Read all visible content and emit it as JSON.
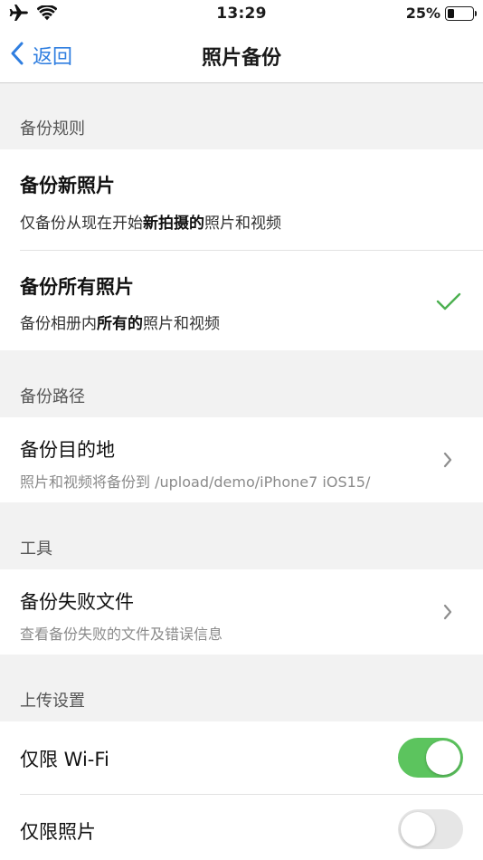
{
  "status_bar": {
    "time": "13:29",
    "battery_percent": "25%",
    "battery_level": 0.25,
    "icons": [
      "airplane-icon",
      "wifi-icon",
      "battery-icon"
    ]
  },
  "nav": {
    "back_label": "返回",
    "title": "照片备份"
  },
  "sections": {
    "rules": {
      "header": "备份规则",
      "new_photos": {
        "title": "备份新照片",
        "sub_prefix": "仅备份从现在开始",
        "sub_bold": "新拍摄的",
        "sub_suffix": "照片和视频"
      },
      "all_photos": {
        "title": "备份所有照片",
        "sub_prefix": "备份相册内",
        "sub_bold": "所有的",
        "sub_suffix": "照片和视频",
        "selected": true
      }
    },
    "path": {
      "header": "备份路径",
      "destination": {
        "title": "备份目的地",
        "subtitle": "照片和视频将备份到 /upload/demo/iPhone7 iOS15/"
      }
    },
    "tools": {
      "header": "工具",
      "failed_files": {
        "title": "备份失败文件",
        "subtitle": "查看备份失败的文件及错误信息"
      }
    },
    "upload": {
      "header": "上传设置",
      "wifi_only": {
        "label": "仅限 Wi-Fi",
        "enabled": true
      },
      "photos_only": {
        "label": "仅限照片",
        "enabled": false
      }
    }
  },
  "colors": {
    "accent": "#2f7ee0",
    "check": "#4cb050",
    "toggle_on": "#5cc45e",
    "toggle_off": "#e6e6e6",
    "background": "#f2f2f2"
  }
}
